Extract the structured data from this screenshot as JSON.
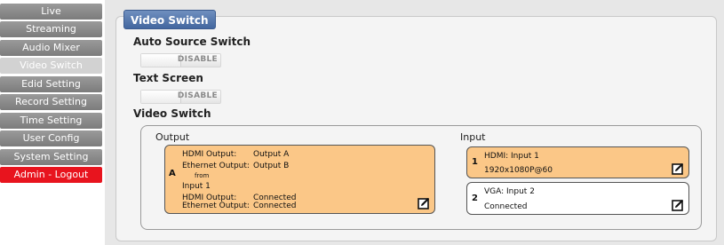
{
  "sidebar": {
    "items": [
      {
        "label": "Live"
      },
      {
        "label": "Streaming"
      },
      {
        "label": "Audio Mixer"
      },
      {
        "label": "Video Switch"
      },
      {
        "label": "Edid Setting"
      },
      {
        "label": "Record Setting"
      },
      {
        "label": "Time Setting"
      },
      {
        "label": "User Config"
      },
      {
        "label": "System Setting"
      },
      {
        "label": "Admin - Logout"
      }
    ]
  },
  "panel": {
    "tab_label": "Video Switch",
    "auto_source_switch": {
      "title": "Auto Source Switch",
      "toggle_label": "DISABLE"
    },
    "text_screen": {
      "title": "Text Screen",
      "toggle_label": "DISABLE"
    },
    "video_switch_title": "Video Switch"
  },
  "output": {
    "title": "Output",
    "card": {
      "letter": "A",
      "hdmi_output_label": "HDMI Output:",
      "hdmi_output_value": "Output A",
      "ethernet_output_label": "Ethernet Output:",
      "ethernet_output_value": "Output B",
      "from": "from",
      "input_name": "Input 1",
      "hdmi_status_label": "HDMI Output:",
      "hdmi_status_value": "Connected",
      "ethernet_status_label": "Ethernet Output:",
      "ethernet_status_value": "Connected"
    }
  },
  "input": {
    "title": "Input",
    "cards": [
      {
        "number": "1",
        "line1": "HDMI:  Input 1",
        "line2": "1920x1080P@60"
      },
      {
        "number": "2",
        "line1": "VGA:  Input 2",
        "line2": "Connected"
      }
    ]
  },
  "colors": {
    "selected_card": "#fbc787",
    "logout": "#e8141e",
    "tab": "#43679f"
  }
}
